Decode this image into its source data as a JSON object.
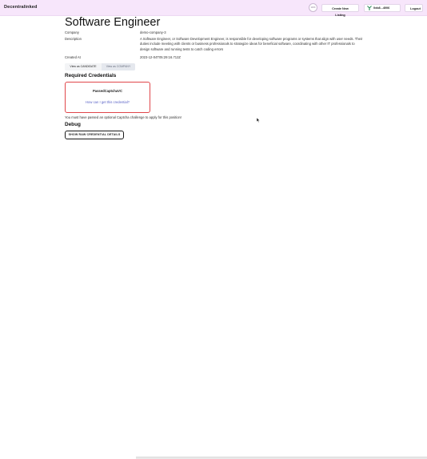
{
  "header": {
    "brand": "Decentralinked",
    "loading_text": "100%",
    "create_listing_label": "Create New Listing",
    "wallet_label": "0xb8...4006",
    "logout_label": "Logout"
  },
  "job": {
    "title": "Software Engineer",
    "fields": [
      {
        "label": "Company",
        "value": "demo-company-3"
      },
      {
        "label": "Description",
        "value": "A Software Engineer, or Software Development Engineer, is responsible for developing software programs or systems that align with user needs. Their duties include meeting with clients or business professionals to strategize ideas for beneficial software, coordinating with other IT professionals to design software and running tests to catch coding errors"
      },
      {
        "label": "Created At",
        "value": "2023-12-04T05:29:16.712Z"
      }
    ]
  },
  "view_toggle": {
    "candidate_label": "View as CANDIDATE",
    "company_label": "View as COMPANY",
    "selected": "CANDIDATE"
  },
  "credentials": {
    "heading": "Required Credentials",
    "items": [
      {
        "name": "PassedCaptchaVC",
        "help_link": "How can I get this credential?"
      }
    ],
    "note": "You must have passed an optional Captcha challenge to apply for this position!"
  },
  "debug": {
    "heading": "Debug",
    "raw_details_label": "SHOW RAW CREDENTIAL DETAILS"
  },
  "colors": {
    "header_bg": "#f7e6fb",
    "credential_border": "#e0464a",
    "link": "#5a63c6"
  },
  "icons": {
    "wallet": "wallet-icon",
    "cursor": "mouse-cursor-icon"
  }
}
